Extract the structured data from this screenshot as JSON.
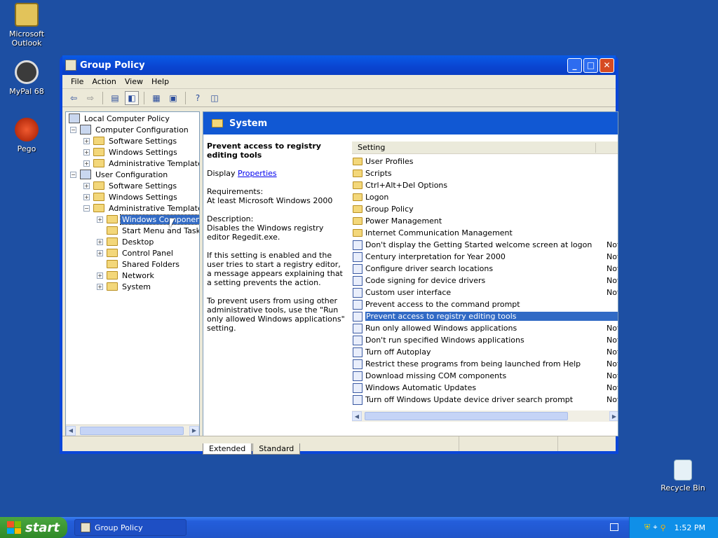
{
  "desktop": {
    "icons": [
      {
        "label": "Microsoft\nOutlook",
        "line1": "Microsoft",
        "line2": "Outlook"
      },
      {
        "line1": "MyPal 68"
      },
      {
        "line1": "Pego"
      },
      {
        "line1": "Recycle Bin"
      }
    ]
  },
  "window": {
    "title": "Group Policy",
    "menu": [
      "File",
      "Action",
      "View",
      "Help"
    ]
  },
  "tree": {
    "root": "Local Computer Policy",
    "computer_config": "Computer Configuration",
    "cc_software": "Software Settings",
    "cc_windows": "Windows Settings",
    "cc_admin": "Administrative Templates",
    "user_config": "User Configuration",
    "uc_software": "Software Settings",
    "uc_windows": "Windows Settings",
    "uc_admin": "Administrative Templates",
    "windows_components": "Windows Components",
    "start_menu": "Start Menu and Taskbar",
    "desktop": "Desktop",
    "control_panel": "Control Panel",
    "shared_folders": "Shared Folders",
    "network": "Network",
    "system": "System"
  },
  "details": {
    "header": "System",
    "policy_title": "Prevent access to registry editing tools",
    "display_label": "Display",
    "display_link": "Properties",
    "requirements_label": "Requirements:",
    "requirements": "At least Microsoft Windows 2000",
    "description_label": "Description:",
    "description": "Disables the Windows registry editor Regedit.exe.",
    "para2": "If this setting is enabled and the user tries to start a registry editor, a message appears explaining that a setting prevents the action.",
    "para3": "To prevent users from using other administrative tools, use the \"Run only allowed Windows applications\" setting."
  },
  "list": {
    "column_setting": "Setting",
    "rows": [
      {
        "name": "User Profiles",
        "type": "folder",
        "state": ""
      },
      {
        "name": "Scripts",
        "type": "folder",
        "state": ""
      },
      {
        "name": "Ctrl+Alt+Del Options",
        "type": "folder",
        "state": ""
      },
      {
        "name": "Logon",
        "type": "folder",
        "state": ""
      },
      {
        "name": "Group Policy",
        "type": "folder",
        "state": ""
      },
      {
        "name": "Power Management",
        "type": "folder",
        "state": ""
      },
      {
        "name": "Internet Communication Management",
        "type": "folder",
        "state": ""
      },
      {
        "name": "Don't display the Getting Started welcome screen at logon",
        "type": "policy",
        "state": "Not"
      },
      {
        "name": "Century interpretation for Year 2000",
        "type": "policy",
        "state": "Not"
      },
      {
        "name": "Configure driver search locations",
        "type": "policy",
        "state": "Not"
      },
      {
        "name": "Code signing for device drivers",
        "type": "policy",
        "state": "Not"
      },
      {
        "name": "Custom user interface",
        "type": "policy",
        "state": "Not"
      },
      {
        "name": "Prevent access to the command prompt",
        "type": "policy",
        "state": ""
      },
      {
        "name": "Prevent access to registry editing tools",
        "type": "policy",
        "state": "",
        "selected": true
      },
      {
        "name": "Run only allowed Windows applications",
        "type": "policy",
        "state": "Not"
      },
      {
        "name": "Don't run specified Windows applications",
        "type": "policy",
        "state": "Not"
      },
      {
        "name": "Turn off Autoplay",
        "type": "policy",
        "state": "Not"
      },
      {
        "name": "Restrict these programs from being launched from Help",
        "type": "policy",
        "state": "Not"
      },
      {
        "name": "Download missing COM components",
        "type": "policy",
        "state": "Not"
      },
      {
        "name": "Windows Automatic Updates",
        "type": "policy",
        "state": "Not"
      },
      {
        "name": "Turn off Windows Update device driver search prompt",
        "type": "policy",
        "state": "Not"
      }
    ]
  },
  "tabs": [
    "Extended",
    "Standard"
  ],
  "taskbar": {
    "start_label": "start",
    "task_label": "Group Policy",
    "clock": "1:52 PM"
  }
}
